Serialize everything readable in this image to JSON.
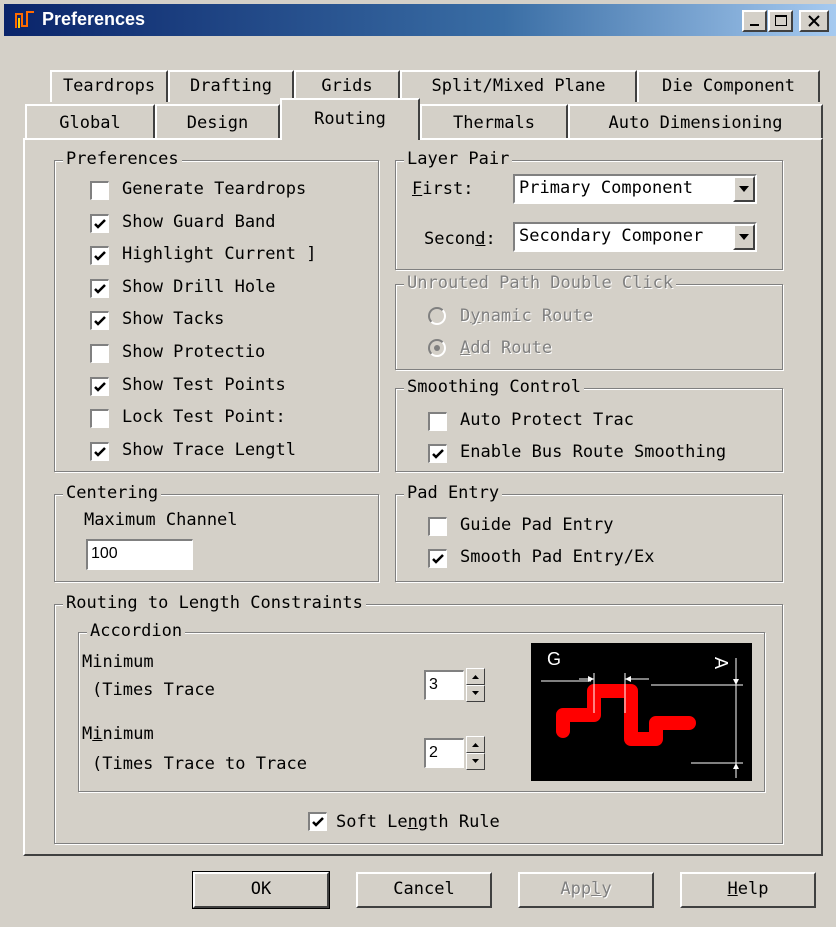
{
  "window": {
    "title": "Preferences"
  },
  "tabs_row1": [
    "Teardrops",
    "Drafting",
    "Grids",
    "Split/Mixed Plane",
    "Die Component"
  ],
  "tabs_row2": [
    "Global",
    "Design",
    "Routing",
    "Thermals",
    "Auto Dimensioning"
  ],
  "active_tab": "Routing",
  "preferences": {
    "title": "Preferences",
    "items": [
      {
        "label": "Generate Teardrops",
        "checked": false
      },
      {
        "label": "Show Guard Band",
        "checked": true
      },
      {
        "label": "Highlight Current ]",
        "checked": true
      },
      {
        "label": "Show Drill Hole",
        "checked": true
      },
      {
        "label": "Show Tacks",
        "checked": true
      },
      {
        "label": "Show Protectio",
        "checked": false
      },
      {
        "label": "Show Test Points",
        "checked": true
      },
      {
        "label": "Lock Test Point:",
        "checked": false
      },
      {
        "label": "Show Trace Lengtl",
        "checked": true
      }
    ]
  },
  "layer_pair": {
    "title": "Layer Pair",
    "first_label": "First:",
    "first_value": "Primary Component",
    "second_label": "Second:",
    "second_value": "Secondary Componer"
  },
  "unrouted": {
    "title": "Unrouted Path Double Click",
    "dynamic_label": "Dynamic Route",
    "add_label": "Add Route",
    "selected": "Add Route"
  },
  "smoothing": {
    "title": "Smoothing Control",
    "items": [
      {
        "label": "Auto Protect Trac",
        "checked": false
      },
      {
        "label": "Enable Bus Route Smoothing",
        "checked": true
      }
    ]
  },
  "centering": {
    "title": "Centering",
    "label": "Maximum Channel",
    "value": "100"
  },
  "pad_entry": {
    "title": "Pad Entry",
    "items": [
      {
        "label": "Guide Pad Entry",
        "checked": false
      },
      {
        "label": "Smooth Pad Entry/Ex",
        "checked": true
      }
    ]
  },
  "routing_length": {
    "title": "Routing to Length Constraints",
    "accordion_title": "Accordion",
    "min1_line1": "Minimum",
    "min1_line2": "(Times Trace",
    "min1_value": "3",
    "min2_line1": "Minimum",
    "min2_line2": "(Times Trace to Trace",
    "min2_value": "2",
    "diagram_g": "G",
    "diagram_a": "A",
    "soft_rule_label": "Soft Length Rule",
    "soft_rule_checked": true
  },
  "buttons": {
    "ok": "OK",
    "cancel": "Cancel",
    "apply": "Apply",
    "help": "Help"
  },
  "colors": {
    "title_start": "#0a246a",
    "title_end": "#a6caf0",
    "face": "#d4d0c8",
    "trace": "#ff0000"
  }
}
